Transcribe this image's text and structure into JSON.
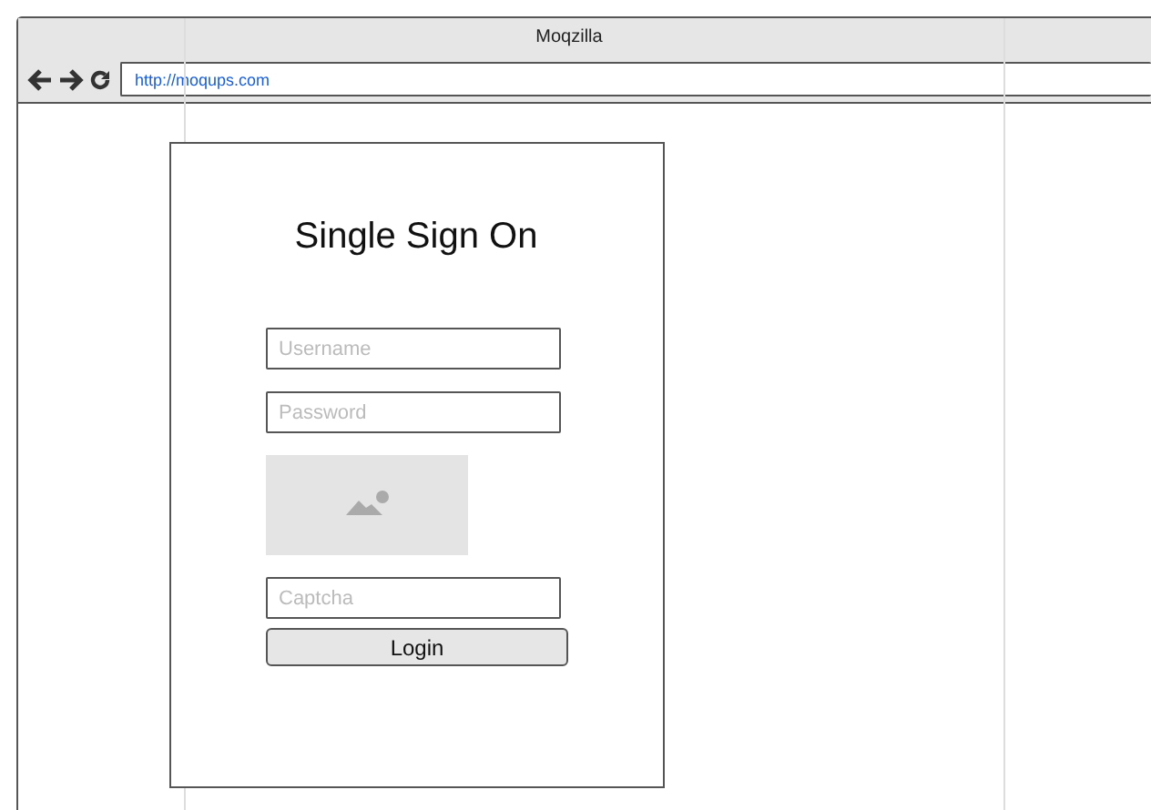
{
  "window": {
    "title": "Moqzilla"
  },
  "address_bar": {
    "value": "http://moqups.com"
  },
  "login_card": {
    "heading": "Single Sign On",
    "fields": [
      {
        "kind": "input",
        "placeholder": "Username"
      },
      {
        "kind": "input",
        "placeholder": "Password"
      },
      {
        "kind": "image"
      },
      {
        "kind": "input",
        "placeholder": "Captcha"
      }
    ],
    "button": "Login"
  }
}
